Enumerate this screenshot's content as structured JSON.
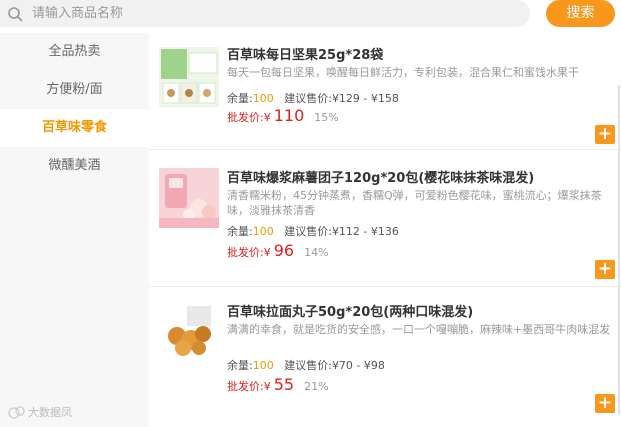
{
  "search": {
    "placeholder": "请输入商品名称",
    "button_label": "搜索"
  },
  "sidebar": {
    "items": [
      {
        "label": "全品热卖",
        "active": false
      },
      {
        "label": "方便粉/面",
        "active": false
      },
      {
        "label": "百草味零食",
        "active": true
      },
      {
        "label": "微醺美酒",
        "active": false
      }
    ]
  },
  "watermark": "大数据凤",
  "products": [
    {
      "name": "百草味每日坚果25g*28袋",
      "desc": "每天一包每日坚果，唤醒每日鲜活力，专利包装，混合果仁和蜜饯水果干",
      "stock_label": "余量:",
      "stock": "100",
      "suggest_label": "建议售价:",
      "suggest_price": "¥129 - ¥158",
      "wholesale_label": "批发价:",
      "currency": "¥",
      "price": "110",
      "discount": "15%"
    },
    {
      "name": "百草味爆浆麻薯团子120g*20包(樱花味抹茶味混发)",
      "desc": "清香糯米粉，45分钟蒸煮，香糯Q弹，可爱粉色樱花味，蜜桃流心；爆浆抹茶味，淡雅抹茶清香",
      "stock_label": "余量:",
      "stock": "100",
      "suggest_label": "建议售价:",
      "suggest_price": "¥112 - ¥136",
      "wholesale_label": "批发价:",
      "currency": "¥",
      "price": "96",
      "discount": "14%"
    },
    {
      "name": "百草味拉面丸子50g*20包(两种口味混发)",
      "desc": "满满的幸食，就是吃货的安全感，一口一个嘎嘣脆，麻辣味+墨西哥牛肉味混发",
      "stock_label": "余量:",
      "stock": "100",
      "suggest_label": "建议售价:",
      "suggest_price": "¥70 - ¥98",
      "wholesale_label": "批发价:",
      "currency": "¥",
      "price": "55",
      "discount": "21%"
    }
  ],
  "add_button_label": "+",
  "colors": {
    "accent": "#f7981d",
    "price": "#e02020",
    "active_category": "#f39800"
  }
}
